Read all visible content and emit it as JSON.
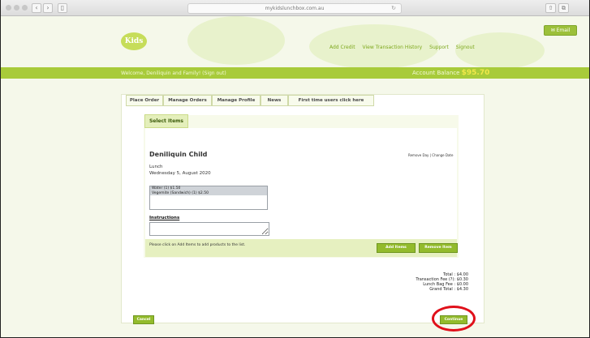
{
  "browser": {
    "url": "mykidslunchbox.com.au",
    "nav_back": "‹",
    "nav_forward": "›",
    "reload": "↻",
    "share": "⇧",
    "tabs_icon": "⧉"
  },
  "header": {
    "logo_text": "Kids",
    "links": [
      "Add Credit",
      "View Transaction History",
      "Support",
      "Signout"
    ],
    "email_button": "✉ Email"
  },
  "welcome_bar": {
    "welcome_text": "Welcome, Deniliquin and Family! (Sign out)",
    "balance_label": "Account Balance",
    "balance_value": "$95.70"
  },
  "tabs": [
    "Place Order",
    "Manage Orders",
    "Manage Profile",
    "News",
    "First time users click here"
  ],
  "select_items": {
    "title": "Select Items",
    "child_name": "Deniliquin Child",
    "day_links": "Remove Day | Change Date",
    "meal": "Lunch",
    "date": "Wednesday 5, August 2020",
    "items": [
      "Water (1) $1.50",
      "Vegemite (Sandwich) (1) $2.50"
    ],
    "instructions_label": "Instructions",
    "instructions_value": "",
    "hint": "Please click on Add Items to add products to the list.",
    "add_button": "Add Items",
    "remove_button": "Remove Item"
  },
  "totals": {
    "total": "Total : $4.00",
    "transaction_fee": "Transaction Fee (?): $0.30",
    "lunch_bag_fee": "Lunch Bag Fee : $0.00",
    "grand_total": "Grand Total : $4.30"
  },
  "actions": {
    "cancel": "Cancel",
    "continue": "Continue"
  },
  "colors": {
    "accent": "#a8cb3a",
    "button": "#93bb2c",
    "highlight": "#e0101a"
  }
}
